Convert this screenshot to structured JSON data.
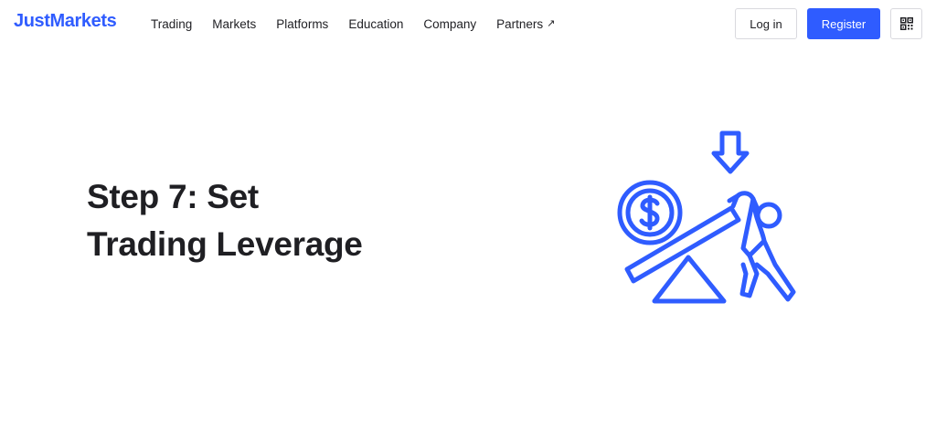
{
  "brand": {
    "logo_text": "JustMarkets",
    "accent_color": "#2f5cff"
  },
  "nav": {
    "items": [
      {
        "label": "Trading"
      },
      {
        "label": "Markets"
      },
      {
        "label": "Platforms"
      },
      {
        "label": "Education"
      },
      {
        "label": "Company"
      },
      {
        "label": "Partners",
        "icon": "external-arrow-icon",
        "icon_glyph": "↗"
      }
    ]
  },
  "header_actions": {
    "login_label": "Log in",
    "register_label": "Register",
    "qr_icon": "qr-code-icon"
  },
  "hero": {
    "title_line1": "Step 7: Set",
    "title_line2": "Trading Leverage",
    "illustration": "leverage-seesaw-icon"
  }
}
